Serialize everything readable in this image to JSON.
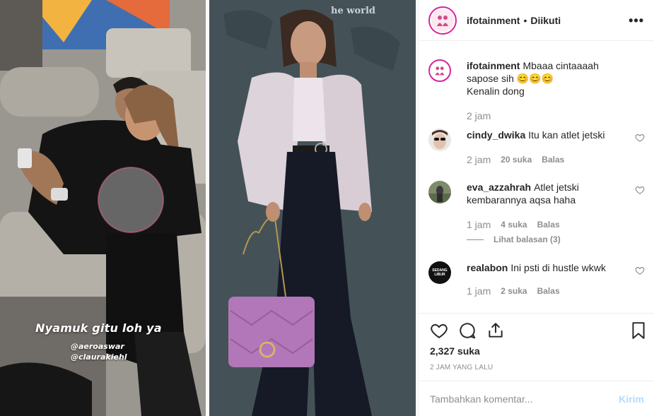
{
  "photo": {
    "story_caption": "Nyamuk gitu loh ya",
    "tags": [
      "@aeroaswar",
      "@claurakiehl"
    ],
    "mural_text": "he world"
  },
  "header": {
    "username": "ifotainment",
    "separator": "•",
    "follow_status": "Diikuti",
    "more_icon": "more-icon"
  },
  "caption": {
    "username": "ifotainment",
    "text_line1": "Mbaaa cintaaaah sapose sih 😊😊😊",
    "text_line2": "Kenalin dong",
    "time": "2 jam"
  },
  "comments": [
    {
      "username": "cindy_dwika",
      "text": "Itu kan atlet jetski",
      "time": "2 jam",
      "likes": "20 suka",
      "reply": "Balas"
    },
    {
      "username": "eva_azzahrah",
      "text": "Atlet jetski kembarannya aqsa haha",
      "time": "1 jam",
      "likes": "4 suka",
      "reply": "Balas",
      "view_replies": "Lihat balasan (3)"
    },
    {
      "username": "realabon",
      "text": "Ini psti di hustle wkwk",
      "time": "1 jam",
      "likes": "2 suka",
      "reply": "Balas",
      "avatar_text": "SEDANG LIBUR"
    }
  ],
  "actions": {
    "likes": "2,327 suka",
    "posted": "2 JAM YANG LALU"
  },
  "comment_box": {
    "placeholder": "Tambahkan komentar...",
    "post_label": "Kirim"
  },
  "colors": {
    "text": "#262626",
    "muted": "#8e8e8e",
    "border": "#efefef",
    "post_disabled": "#b3dbff",
    "story_ring": "#d6249f"
  }
}
